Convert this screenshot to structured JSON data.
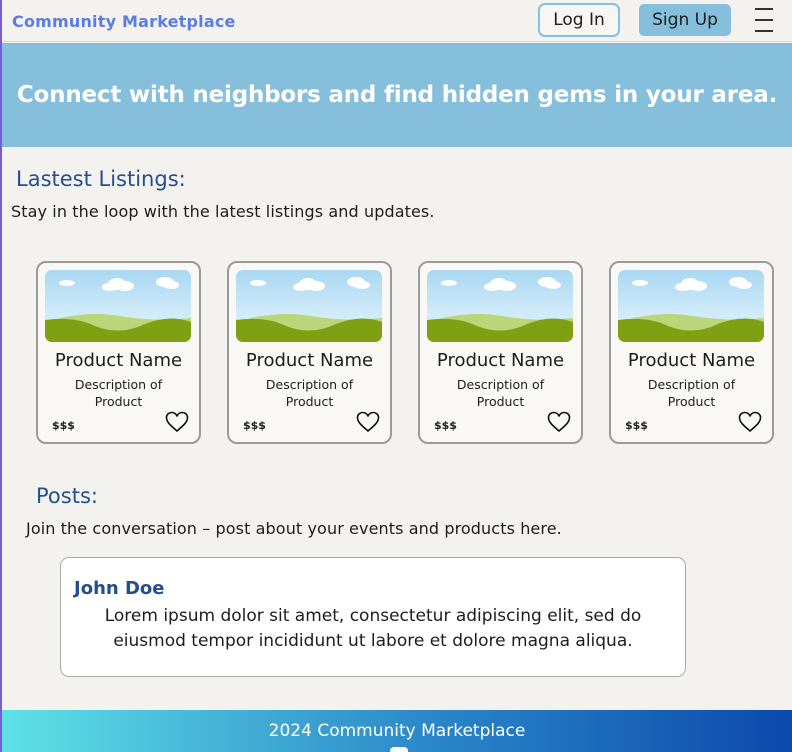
{
  "header": {
    "brand": "Community Marketplace",
    "login_label": "Log In",
    "signup_label": "Sign Up",
    "menu_icon": "hamburger-icon"
  },
  "hero": {
    "text": "Connect with neighbors and find hidden gems in your area."
  },
  "listings": {
    "title": "Lastest Listings:",
    "subtitle": "Stay in the loop with the latest listings and updates.",
    "cards": [
      {
        "name": "Product Name",
        "desc1": "Description of",
        "desc2": "Product",
        "price": "$$$"
      },
      {
        "name": "Product Name",
        "desc1": "Description of",
        "desc2": "Product",
        "price": "$$$"
      },
      {
        "name": "Product Name",
        "desc1": "Description of",
        "desc2": "Product",
        "price": "$$$"
      },
      {
        "name": "Product Name",
        "desc1": "Description of",
        "desc2": "Product",
        "price": "$$$"
      }
    ]
  },
  "posts": {
    "title": "Posts:",
    "subtitle": "Join the conversation – post about your events and products here.",
    "items": [
      {
        "author": "John Doe",
        "body": "Lorem ipsum dolor sit amet, consectetur adipiscing elit, sed do eiusmod tempor incididunt ut labore et dolore magna aliqua."
      }
    ]
  },
  "footer": {
    "text": "2024 Community Marketplace"
  },
  "colors": {
    "brand": "#5b7de0",
    "hero_bg": "#86bfdc",
    "section_title": "#244f8f",
    "signup_bg": "#86bfdc"
  }
}
